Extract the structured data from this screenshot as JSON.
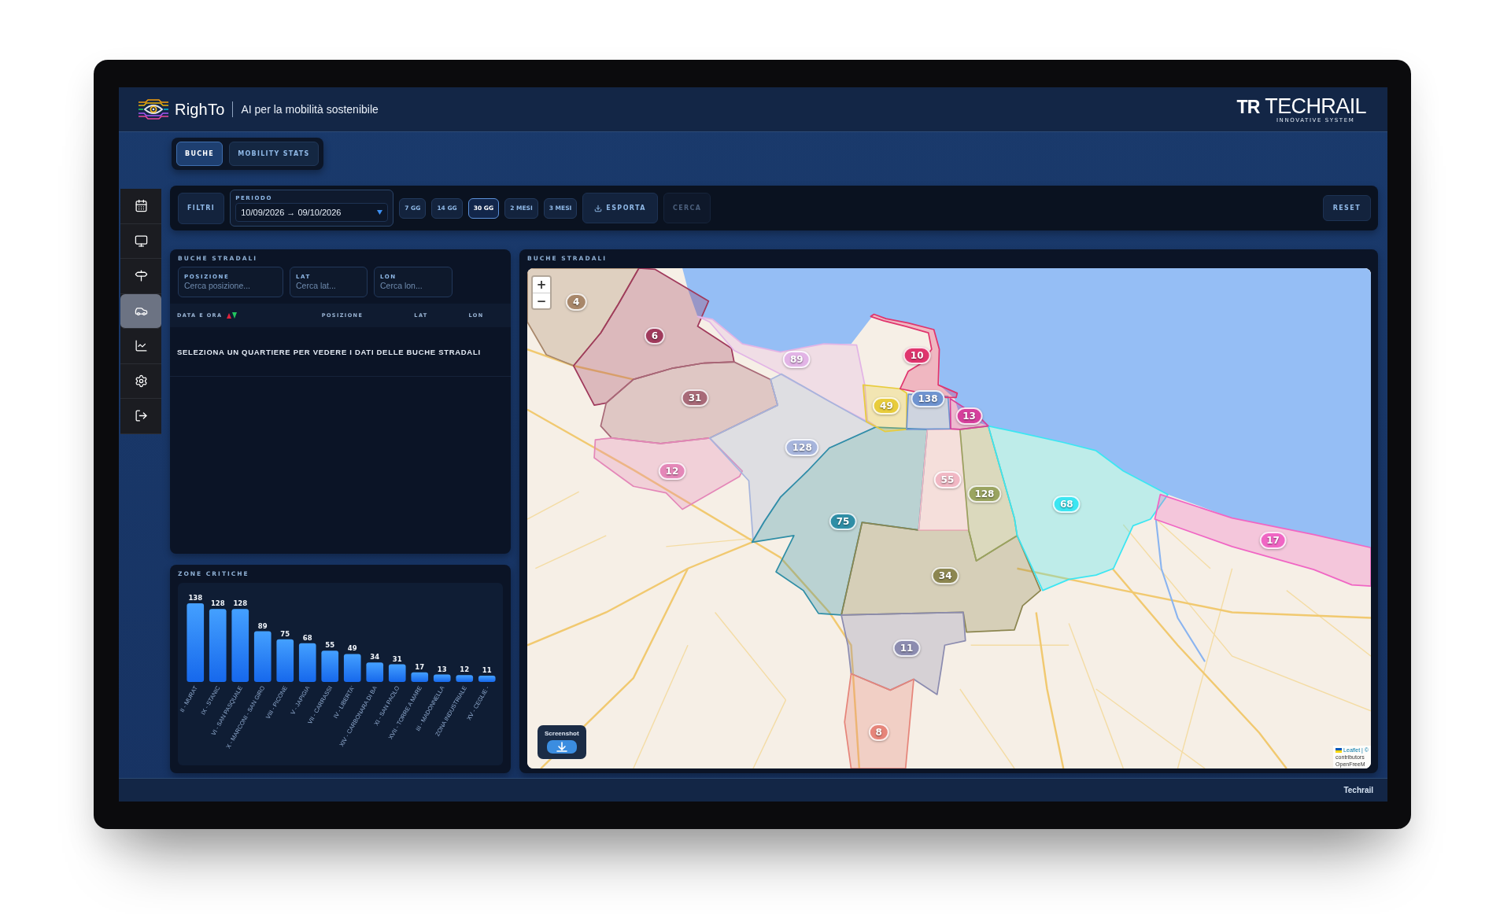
{
  "header": {
    "brand": "RighTo",
    "tagline": "AI per la mobilità sostenibile",
    "partner": {
      "mark": "TR",
      "name": "TECHRAIL",
      "subtitle": "INNOVATIVE SYSTEM"
    }
  },
  "tabs": [
    {
      "label": "BUCHE",
      "selected": true
    },
    {
      "label": "MOBILITY STATS",
      "selected": false
    }
  ],
  "sidebar": {
    "items": [
      {
        "selected": false
      },
      {
        "selected": false
      },
      {
        "selected": false
      },
      {
        "selected": true
      },
      {
        "selected": false
      },
      {
        "selected": false
      },
      {
        "selected": false
      }
    ]
  },
  "filters": {
    "button": "FILTRI",
    "period": {
      "label": "PERIODO",
      "value": "10/09/2026 → 09/10/2026"
    },
    "ranges": [
      {
        "label": "7 GG",
        "selected": false
      },
      {
        "label": "14 GG",
        "selected": false
      },
      {
        "label": "30 GG",
        "selected": true
      },
      {
        "label": "2 MESI",
        "selected": false
      },
      {
        "label": "3 MESI",
        "selected": false
      }
    ],
    "export": "ESPORTA",
    "search": {
      "label": "CERCA",
      "disabled": true
    },
    "reset": "RESET"
  },
  "potholes_panel": {
    "title": "BUCHE STRADALI",
    "search_fields": [
      {
        "label": "POSIZIONE",
        "placeholder": "Cerca posizione..."
      },
      {
        "label": "LAT",
        "placeholder": "Cerca lat..."
      },
      {
        "label": "LON",
        "placeholder": "Cerca lon..."
      }
    ],
    "table": {
      "columns": [
        {
          "label": "DATA E ORA",
          "sortable": true
        },
        {
          "label": "POSIZIONE",
          "sortable": false
        },
        {
          "label": "LAT",
          "sortable": false
        },
        {
          "label": "LON",
          "sortable": false
        }
      ],
      "empty_message": "SELEZIONA UN QUARTIERE PER VEDERE I DATI DELLE BUCHE STRADALI"
    }
  },
  "critical_zones": {
    "title": "ZONE CRITICHE",
    "chart_data": {
      "type": "bar",
      "categories": [
        "II - MURAT",
        "IX - STANIC",
        "VI - SAN PASQUALE",
        "X - MARCONI - SAN GIRO",
        "VIII - PICONE",
        "V - JAPIGIA",
        "VII - CARRASSI",
        "IV - LIBERTA'",
        "XIV - CARBONARA DI BA",
        "XI - SAN PAOLO",
        "XVII - TORRE A MARE",
        "III - MADONNELLA",
        "ZONA INDUSTRIALE",
        "XV - CEGLIE -"
      ],
      "values": [
        138,
        128,
        128,
        89,
        75,
        68,
        55,
        49,
        34,
        31,
        17,
        13,
        12,
        11
      ],
      "data_labels": true
    }
  },
  "map_panel": {
    "title": "BUCHE STRADALI",
    "zoom_in": "+",
    "zoom_out": "−",
    "clusters": [
      {
        "count": "4",
        "color": "#a8876a"
      },
      {
        "count": "6",
        "color": "#a03a5c"
      },
      {
        "count": "10",
        "color": "#e0356e"
      },
      {
        "count": "89",
        "color": "#e2b4e6"
      },
      {
        "count": "31",
        "color": "#a86a78"
      },
      {
        "count": "138",
        "color": "#6f94d0"
      },
      {
        "count": "49",
        "color": "#e8cc3c"
      },
      {
        "count": "13",
        "color": "#d6409c"
      },
      {
        "count": "128",
        "color": "#a7b5dc"
      },
      {
        "count": "12",
        "color": "#e487b8"
      },
      {
        "count": "55",
        "color": "#f1b8c4"
      },
      {
        "count": "128",
        "color": "#9aa460"
      },
      {
        "count": "68",
        "color": "#3ce6f2"
      },
      {
        "count": "75",
        "color": "#2f8ea6"
      },
      {
        "count": "17",
        "color": "#f066c4"
      },
      {
        "count": "34",
        "color": "#8c8650"
      },
      {
        "count": "11",
        "color": "#8c8cb0"
      },
      {
        "count": "8",
        "color": "#e6857a"
      }
    ],
    "screenshot_button": "Screenshot",
    "attribution": [
      "Leaflet | ©",
      "contributors",
      "OpenFreeM"
    ]
  },
  "footer": {
    "brand": "Techrail"
  }
}
